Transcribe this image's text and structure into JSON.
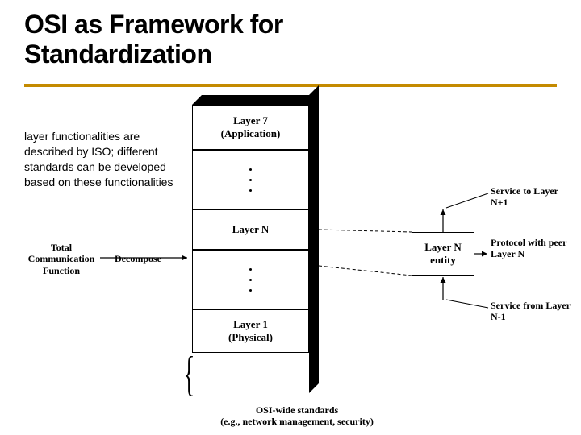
{
  "title_line1": "OSI as Framework for",
  "title_line2": "Standardization",
  "description": "layer functionalities are described by ISO; different standards can be developed based on these functionalities",
  "stack": {
    "layer7_name": "Layer 7",
    "layer7_sub": "(Application)",
    "layerN_name": "Layer N",
    "layer1_name": "Layer 1",
    "layer1_sub": "(Physical)"
  },
  "entity": {
    "line1": "Layer N",
    "line2": "entity"
  },
  "left_labels": {
    "total_comm": "Total Communication Function",
    "decompose": "Decompose"
  },
  "right_labels": {
    "service_to": "Service to Layer N+1",
    "protocol": "Protocol with peer Layer N",
    "service_from": "Service from Layer N-1"
  },
  "caption_line1": "OSI-wide standards",
  "caption_line2": "(e.g., network management, security)"
}
